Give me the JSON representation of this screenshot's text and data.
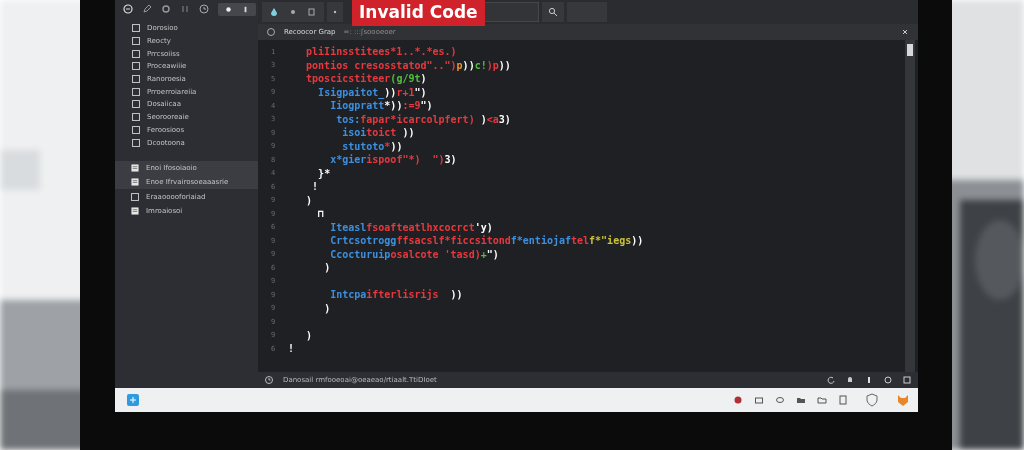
{
  "overlay_label": "Invalid Code",
  "sidebar": {
    "items": [
      {
        "label": "Dorosioo",
        "kind": "box"
      },
      {
        "label": "Reocty",
        "kind": "box"
      },
      {
        "label": "Prrcsoiiss",
        "kind": "box"
      },
      {
        "label": "Proceawiiie",
        "kind": "box"
      },
      {
        "label": "Ranoroesia",
        "kind": "box"
      },
      {
        "label": "Prroerroiareiia",
        "kind": "box"
      },
      {
        "label": "Dosaiicaa",
        "kind": "box"
      },
      {
        "label": "Seorooreaie",
        "kind": "box"
      },
      {
        "label": "Feroosioos",
        "kind": "box"
      },
      {
        "label": "Dcootoona",
        "kind": "box"
      }
    ],
    "recent": [
      {
        "label": "Enoi Ifosoiaoio",
        "kind": "doc",
        "selected": true
      },
      {
        "label": "Enoe Ifrvairosoeaaasrie",
        "kind": "doc",
        "selected": true
      },
      {
        "label": "Eraaooooforiaiad",
        "kind": "box",
        "selected": false
      },
      {
        "label": "Imroaiosoi",
        "kind": "doc",
        "selected": false
      }
    ]
  },
  "editor": {
    "tab": {
      "label": "Recoocor Grap",
      "detail": "=: :::ʃsoooeoer"
    },
    "lines": [
      {
        "number": "1",
        "segments": [
          {
            "text": "   pliIinsstitees*1..*.*es.)",
            "kind": "string"
          }
        ]
      },
      {
        "number": "3",
        "segments": [
          {
            "text": "   pontios cresosstatod\"..\")",
            "kind": "string"
          },
          {
            "text": "p",
            "kind": "number"
          },
          {
            "text": "))",
            "kind": "punct"
          },
          {
            "text": "c!",
            "kind": "literal"
          },
          {
            "text": ")p",
            "kind": "string"
          },
          {
            "text": "))",
            "kind": "punct"
          }
        ]
      },
      {
        "number": "5",
        "segments": [
          {
            "text": "   tposcicstiteer",
            "kind": "string"
          },
          {
            "text": "(g/9t",
            "kind": "literal"
          },
          {
            "text": ")",
            "kind": "punct"
          }
        ]
      },
      {
        "number": "9",
        "segments": [
          {
            "text": "     Isigpaitot_",
            "kind": "name"
          },
          {
            "text": "))",
            "kind": "punct"
          },
          {
            "text": "r+1",
            "kind": "string"
          },
          {
            "text": "\")",
            "kind": "punct"
          }
        ]
      },
      {
        "number": "4",
        "segments": [
          {
            "text": "       Iiogpratt",
            "kind": "name"
          },
          {
            "text": "*))",
            "kind": "punct"
          },
          {
            "text": ":=9",
            "kind": "string"
          },
          {
            "text": "\")",
            "kind": "punct"
          }
        ]
      },
      {
        "number": "3",
        "segments": [
          {
            "text": "        tos:",
            "kind": "name"
          },
          {
            "text": "fapar*icarcolpfert)",
            "kind": "string"
          },
          {
            "text": " )",
            "kind": "punct"
          },
          {
            "text": "<a",
            "kind": "string"
          },
          {
            "text": "3)",
            "kind": "punct"
          }
        ]
      },
      {
        "number": "9",
        "segments": [
          {
            "text": "         isoi",
            "kind": "name"
          },
          {
            "text": "toict",
            "kind": "string"
          },
          {
            "text": " ))",
            "kind": "punct"
          }
        ]
      },
      {
        "number": "9",
        "segments": [
          {
            "text": "         stutoto",
            "kind": "name"
          },
          {
            "text": "*",
            "kind": "string"
          },
          {
            "text": "))",
            "kind": "punct"
          }
        ]
      },
      {
        "number": "8",
        "segments": [
          {
            "text": "       x*gier",
            "kind": "name"
          },
          {
            "text": "ispoof\"*)  \")",
            "kind": "string"
          },
          {
            "text": "3)",
            "kind": "punct"
          }
        ]
      },
      {
        "number": "4",
        "segments": [
          {
            "text": "     }*",
            "kind": "punct"
          }
        ]
      },
      {
        "number": "6",
        "segments": [
          {
            "text": "    !",
            "kind": "punct"
          }
        ]
      },
      {
        "number": "9",
        "segments": [
          {
            "text": "   )",
            "kind": "punct"
          }
        ]
      },
      {
        "number": "9",
        "segments": [
          {
            "text": "     ⊓",
            "kind": "punct"
          }
        ]
      },
      {
        "number": "6",
        "segments": [
          {
            "text": "       Iteasl",
            "kind": "name"
          },
          {
            "text": "fsoafteatlhxcocrct",
            "kind": "string"
          },
          {
            "text": "'y)",
            "kind": "punct"
          }
        ]
      },
      {
        "number": "9",
        "segments": [
          {
            "text": "       Crtcsotrogg",
            "kind": "name"
          },
          {
            "text": "ffsacslf*ficcsitond",
            "kind": "string"
          },
          {
            "text": "f*entiojaf",
            "kind": "name"
          },
          {
            "text": "tel",
            "kind": "string"
          },
          {
            "text": "f*\"iegs",
            "kind": "value"
          },
          {
            "text": "))",
            "kind": "punct"
          }
        ]
      },
      {
        "number": "9",
        "segments": [
          {
            "text": "       Ccocturuip",
            "kind": "name"
          },
          {
            "text": "osalcote 'tasd)",
            "kind": "string"
          },
          {
            "text": "+",
            "kind": "literal"
          },
          {
            "text": "\")",
            "kind": "punct"
          }
        ]
      },
      {
        "number": "6",
        "segments": [
          {
            "text": "      )",
            "kind": "punct"
          }
        ]
      },
      {
        "number": "9"
      },
      {
        "number": "9",
        "segments": [
          {
            "text": "       Intcpa",
            "kind": "name"
          },
          {
            "text": "ifterlisrijs",
            "kind": "string"
          },
          {
            "text": "  ))",
            "kind": "punct"
          }
        ]
      },
      {
        "number": "9",
        "segments": [
          {
            "text": "      )",
            "kind": "punct"
          }
        ]
      },
      {
        "number": "9"
      },
      {
        "number": "9",
        "segments": [
          {
            "text": "   )",
            "kind": "punct"
          }
        ]
      },
      {
        "number": "6",
        "segments": [
          {
            "text": "!",
            "kind": "punct"
          }
        ]
      }
    ]
  },
  "status_bar": {
    "text": "Danosail rmfooeoai@oeaeao/rtiaalt.TtiDIoet"
  }
}
